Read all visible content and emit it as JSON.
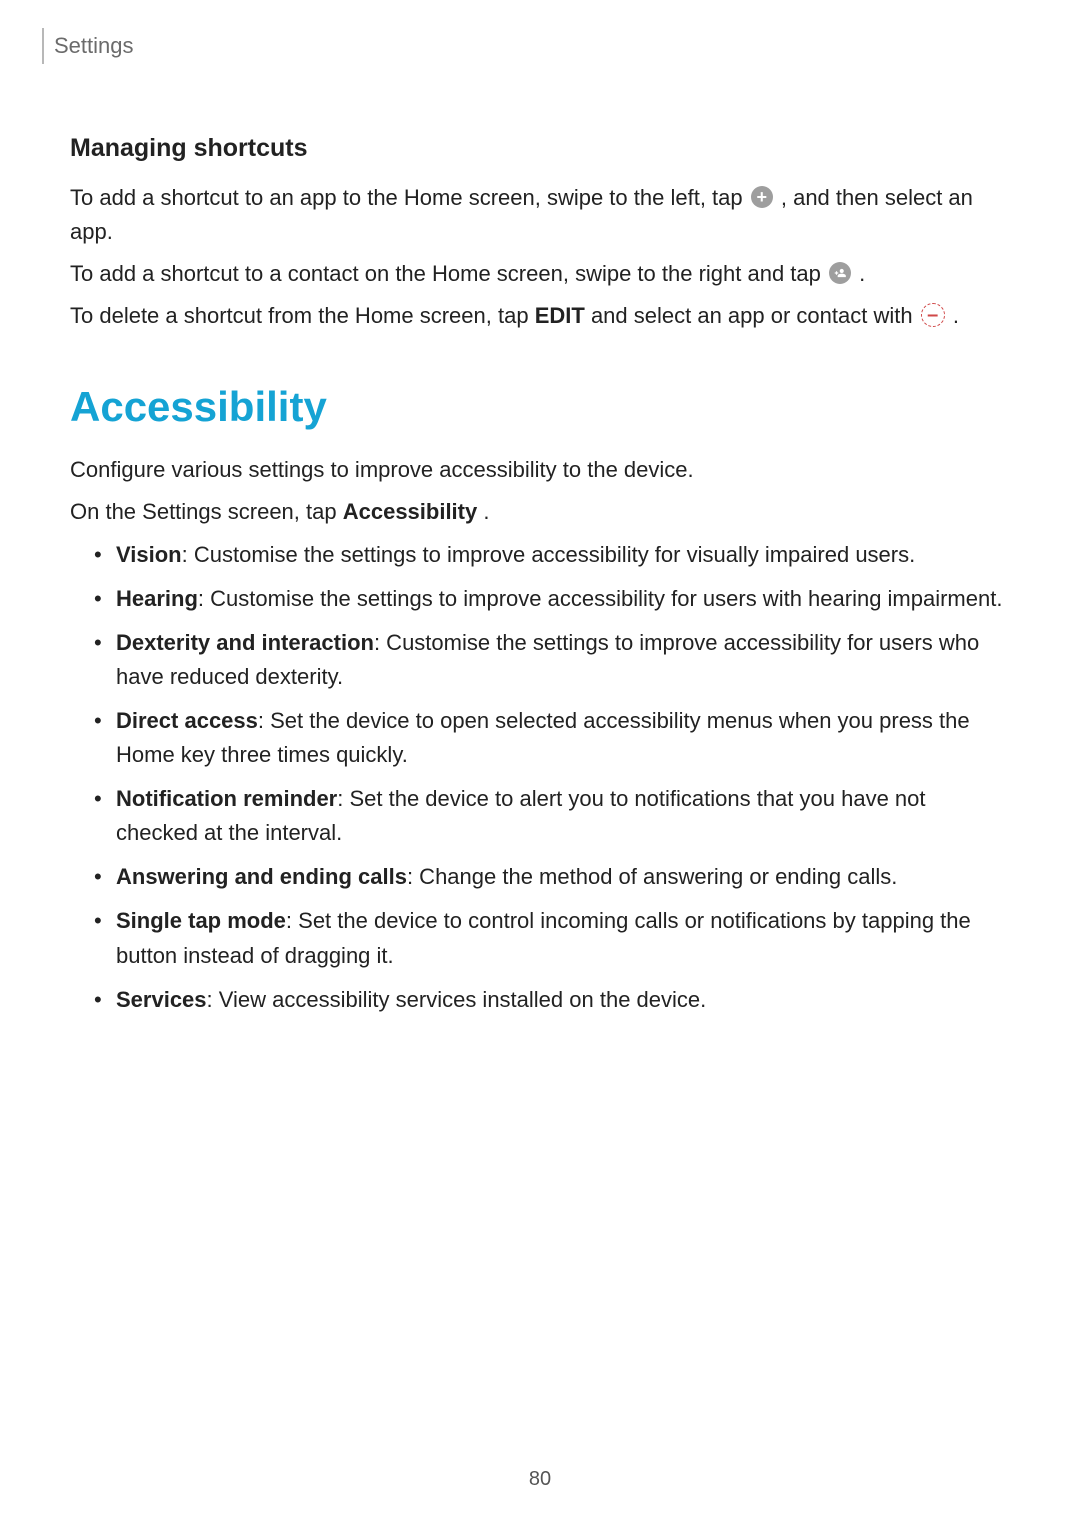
{
  "header": {
    "title": "Settings"
  },
  "subHeading": "Managing shortcuts",
  "para1": {
    "t1": "To add a shortcut to an app to the Home screen, swipe to the left, tap ",
    "t2": ", and then select an app."
  },
  "para2": {
    "t1": "To add a shortcut to a contact on the Home screen, swipe to the right and tap ",
    "t2": "."
  },
  "para3": {
    "t1": "To delete a shortcut from the Home screen, tap ",
    "bold": "EDIT",
    "t2": " and select an app or contact with ",
    "t3": "."
  },
  "mainHeading": "Accessibility",
  "introPara": "Configure various settings to improve accessibility to the device.",
  "navPara": {
    "t1": "On the Settings screen, tap ",
    "bold": "Accessibility",
    "t2": "."
  },
  "bullets": [
    {
      "label": "Vision",
      "text": ": Customise the settings to improve accessibility for visually impaired users."
    },
    {
      "label": "Hearing",
      "text": ": Customise the settings to improve accessibility for users with hearing impairment."
    },
    {
      "label": "Dexterity and interaction",
      "text": ": Customise the settings to improve accessibility for users who have reduced dexterity."
    },
    {
      "label": "Direct access",
      "text": ": Set the device to open selected accessibility menus when you press the Home key three times quickly."
    },
    {
      "label": "Notification reminder",
      "text": ": Set the device to alert you to notifications that you have not checked at the interval."
    },
    {
      "label": "Answering and ending calls",
      "text": ": Change the method of answering or ending calls."
    },
    {
      "label": "Single tap mode",
      "text": ": Set the device to control incoming calls or notifications by tapping the button instead of dragging it."
    },
    {
      "label": "Services",
      "text": ": View accessibility services installed on the device."
    }
  ],
  "pageNumber": "80"
}
